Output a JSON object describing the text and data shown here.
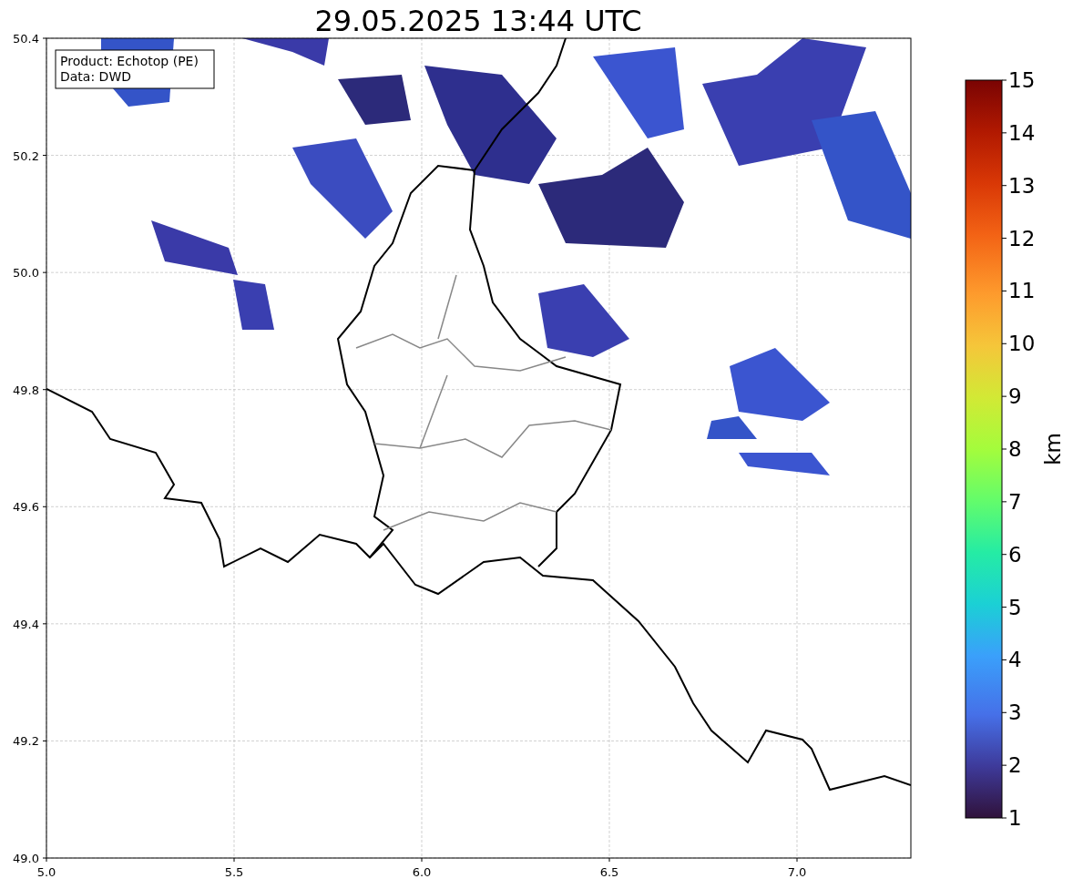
{
  "title": "29.05.2025 13:44 UTC",
  "info_box": [
    "Product: Echotop (PE)",
    "Data: DWD"
  ],
  "x_axis": {
    "ticks": [
      "5.0",
      "5.5",
      "6.0",
      "6.5",
      "7.0"
    ]
  },
  "y_axis": {
    "ticks": [
      "50.4",
      "50.2",
      "50.0",
      "49.8",
      "49.6",
      "49.4",
      "49.2",
      "49.0"
    ]
  },
  "colorbar": {
    "label": "km",
    "ticks": [
      "15",
      "14",
      "13",
      "12",
      "11",
      "10",
      "9",
      "8",
      "7",
      "6",
      "5",
      "4",
      "3",
      "2",
      "1"
    ]
  }
}
